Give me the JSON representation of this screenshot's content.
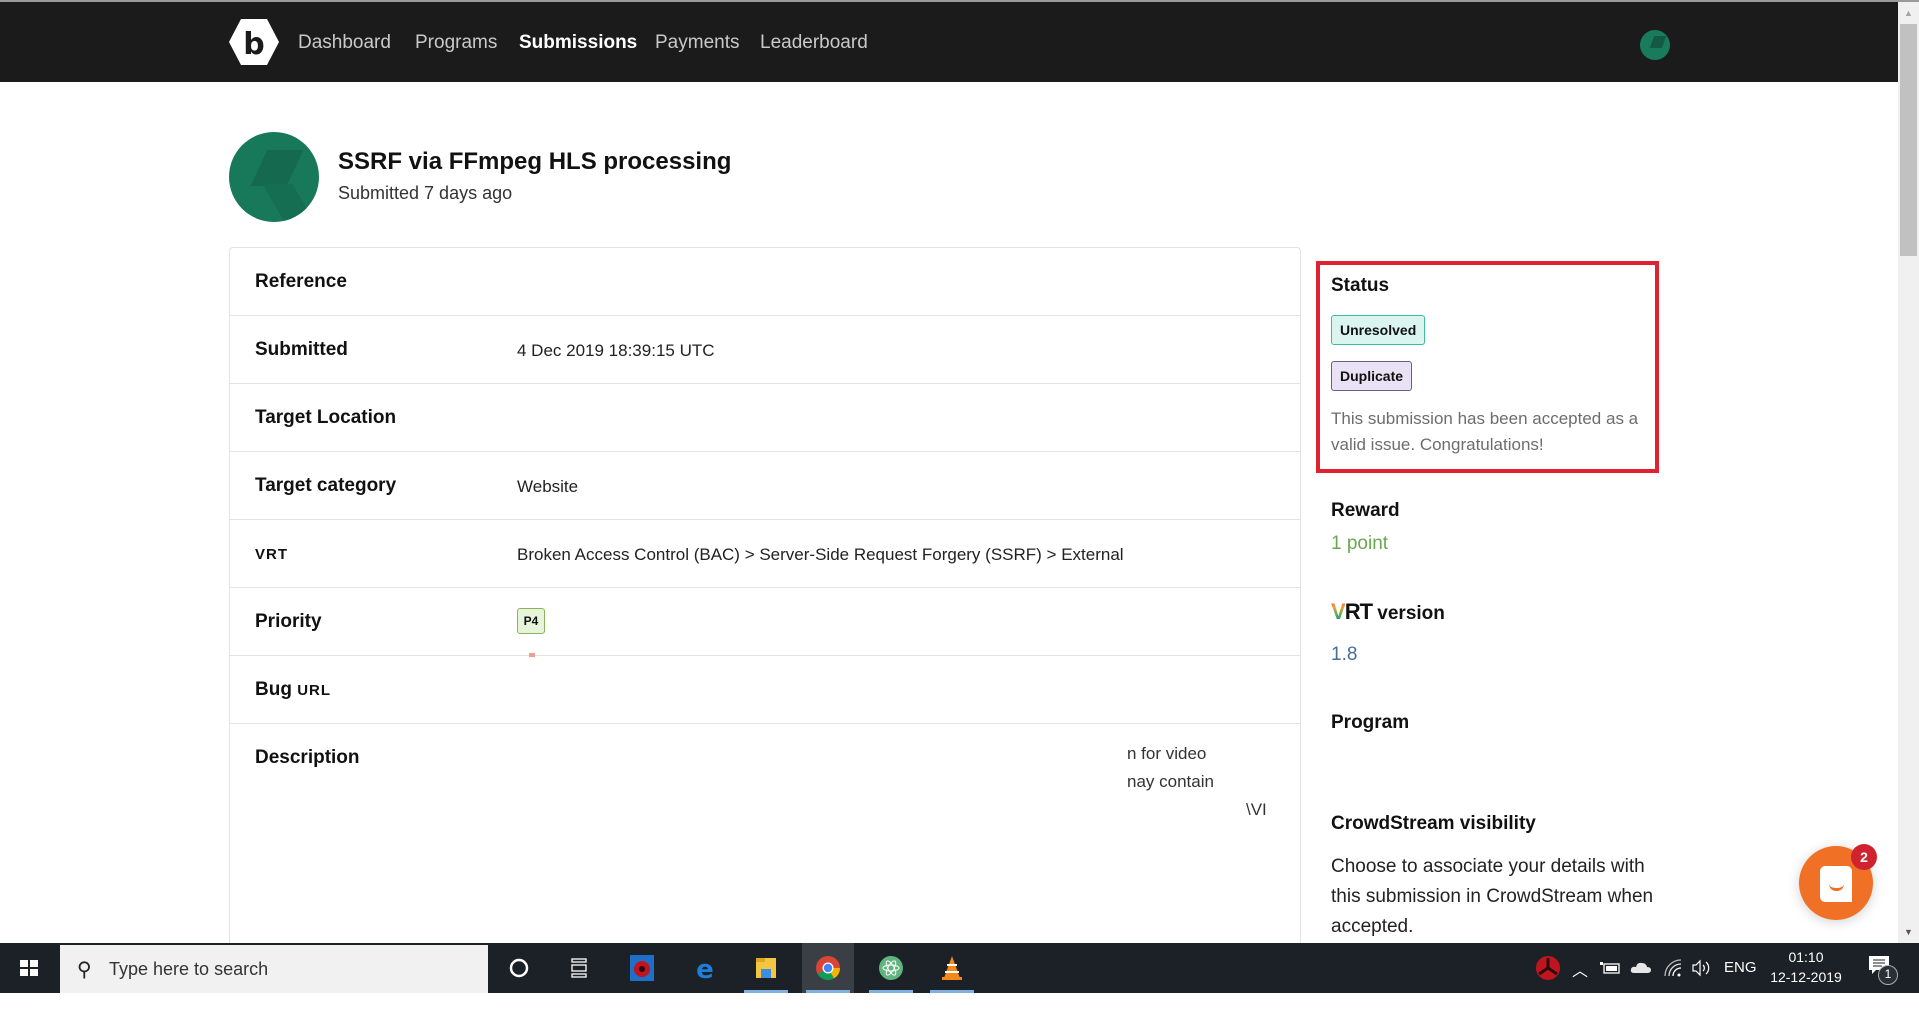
{
  "navbar": {
    "logo_letter": "b",
    "items": [
      {
        "label": "Dashboard",
        "active": false
      },
      {
        "label": "Programs",
        "active": false
      },
      {
        "label": "Submissions",
        "active": true
      },
      {
        "label": "Payments",
        "active": false
      },
      {
        "label": "Leaderboard",
        "active": false
      }
    ]
  },
  "submission": {
    "title": "SSRF via FFmpeg HLS processing",
    "subtitle": "Submitted 7 days ago"
  },
  "details": {
    "rows": [
      {
        "label": "Reference",
        "value": ""
      },
      {
        "label": "Submitted",
        "value": "4 Dec 2019 18:39:15 UTC"
      },
      {
        "label": "Target Location",
        "value": ""
      },
      {
        "label": "Target category",
        "value": "Website"
      },
      {
        "label": "VRT",
        "value": "Broken Access Control (BAC) > Server-Side Request Forgery (SSRF) > External"
      },
      {
        "label": "Priority",
        "value": "P4"
      },
      {
        "label_prefix": "Bug ",
        "label_abbr": "URL",
        "value": ""
      },
      {
        "label": "Description",
        "value": ""
      }
    ],
    "description_fragments": [
      "n for video",
      "nay contain",
      "\\VI"
    ]
  },
  "sidebar": {
    "status": {
      "heading": "Status",
      "badges": [
        {
          "label": "Unresolved",
          "color": "#daf5ef"
        },
        {
          "label": "Duplicate",
          "color": "#e8e2f4"
        }
      ],
      "note": "This submission has been accepted as a valid issue. Congratulations!",
      "highlight_color": "#e02130"
    },
    "reward": {
      "heading": "Reward",
      "value": "1 point",
      "color": "#6aa84f"
    },
    "vrt_version": {
      "logo_text": "VRT",
      "heading_suffix": " version",
      "value": "1.8"
    },
    "program": {
      "heading": "Program"
    },
    "crowdstream": {
      "heading": "CrowdStream visibility",
      "text": "Choose to associate your details with this submission in CrowdStream when accepted."
    }
  },
  "chat_widget": {
    "unread_count": "2",
    "color": "#f07026"
  },
  "taskbar": {
    "search_placeholder": "Type here to search",
    "pinned_apps": [
      "cortana-icon",
      "task-view-icon",
      "antivirus-icon",
      "edge-icon",
      "file-explorer-icon",
      "chrome-icon",
      "atom-icon",
      "vlc-icon"
    ],
    "language": "ENG",
    "time": "01:10",
    "date": "12-12-2019",
    "notification_count": "1"
  }
}
